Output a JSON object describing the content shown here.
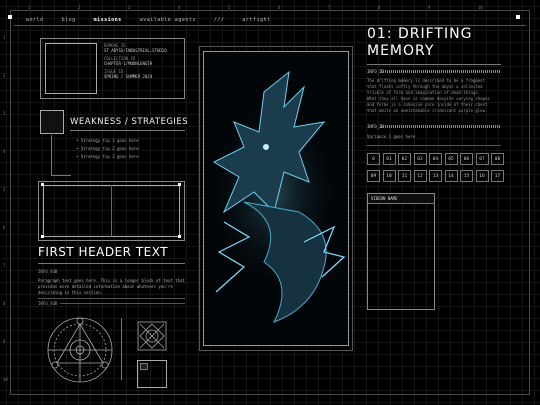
{
  "nav": {
    "items": [
      "world",
      "blog",
      "missions",
      "available agents",
      "///",
      "artfight"
    ],
    "active": "missions"
  },
  "rulers": {
    "top": [
      "1",
      "2",
      "3",
      "4",
      "5",
      "6",
      "7",
      "8",
      "9",
      "10"
    ],
    "side": [
      "1",
      "2",
      "3",
      "4",
      "5",
      "6",
      "7",
      "8",
      "9",
      "10"
    ]
  },
  "meta": {
    "label1": "REMOVE_ID",
    "value1": "ST_ABYSS/INDUSTRIAL.STUDIO",
    "label2": "COLLECTION_ID",
    "value2": "CHAPTER-1/MOONLENGTH",
    "label3": "ISSUE_ID",
    "value3": "SPRING / SUMMER 2024"
  },
  "section": {
    "heading": "WEAKNESS / STRATEGIES",
    "strategies": [
      "Strategy tip 1 goes here",
      "Strategy tip 2 goes here",
      "Strategy tip 3 goes here"
    ]
  },
  "first": {
    "heading": "FIRST HEADER TEXT",
    "label": "INFO_SUB",
    "paragraph": [
      "Paragraph text goes here. This is a longer block of text that",
      "provides more detailed information about whatever you're",
      "describing in this section."
    ],
    "label2": "INFO_SUB"
  },
  "title": {
    "line1": "01: DRIFTING",
    "line2": "MEMORY"
  },
  "info1": {
    "label": "INFO_ID",
    "text": [
      "The drifting memory is described to be a fragment",
      "that floats softly through the abyss a collected",
      "trickle of form and imagination of dead things.",
      "What they all have is common despite varying shapes",
      "and forms is a cohesive core inside of their chest",
      "that emits an unmistakable iridescent purple glow."
    ]
  },
  "info2": {
    "label": "INFO_ID",
    "text": "Variance 1 goes here"
  },
  "numbers": [
    "0",
    "01",
    "02",
    "03",
    "04",
    "05",
    "06",
    "07",
    "08",
    "09",
    "10",
    "11",
    "12",
    "13",
    "14",
    "15",
    "16",
    "17"
  ],
  "video": {
    "heading": "VIDEON NAME"
  },
  "colors": {
    "accent": "#4aa8c8",
    "frame": "#888888"
  }
}
